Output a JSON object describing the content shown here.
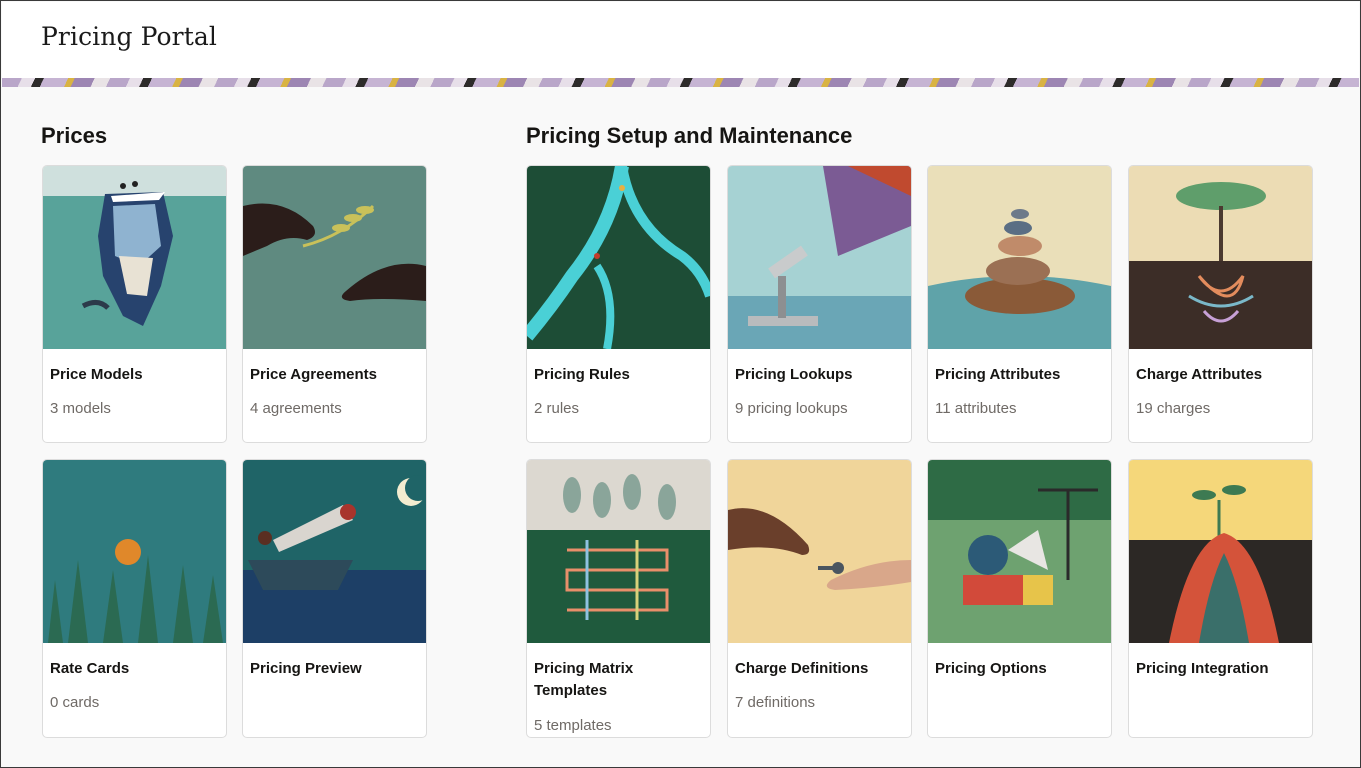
{
  "header": {
    "app_title": "Pricing Portal"
  },
  "sections": {
    "prices": {
      "title": "Prices",
      "cards": [
        {
          "title": "Price Models",
          "count": "3 models"
        },
        {
          "title": "Price Agreements",
          "count": "4 agreements"
        },
        {
          "title": "Rate Cards",
          "count": "0 cards"
        },
        {
          "title": "Pricing Preview",
          "count": ""
        }
      ]
    },
    "setup": {
      "title": "Pricing Setup and Maintenance",
      "cards": [
        {
          "title": "Pricing Rules",
          "count": "2 rules"
        },
        {
          "title": "Pricing Lookups",
          "count": "9 pricing lookups"
        },
        {
          "title": "Pricing Attributes",
          "count": "11 attributes"
        },
        {
          "title": "Charge Attributes",
          "count": "19 charges"
        },
        {
          "title": "Pricing Matrix Templates",
          "count": "5 templates"
        },
        {
          "title": "Charge Definitions",
          "count": "7 definitions"
        },
        {
          "title": "Pricing Options",
          "count": ""
        },
        {
          "title": "Pricing Integration",
          "count": ""
        }
      ]
    }
  }
}
